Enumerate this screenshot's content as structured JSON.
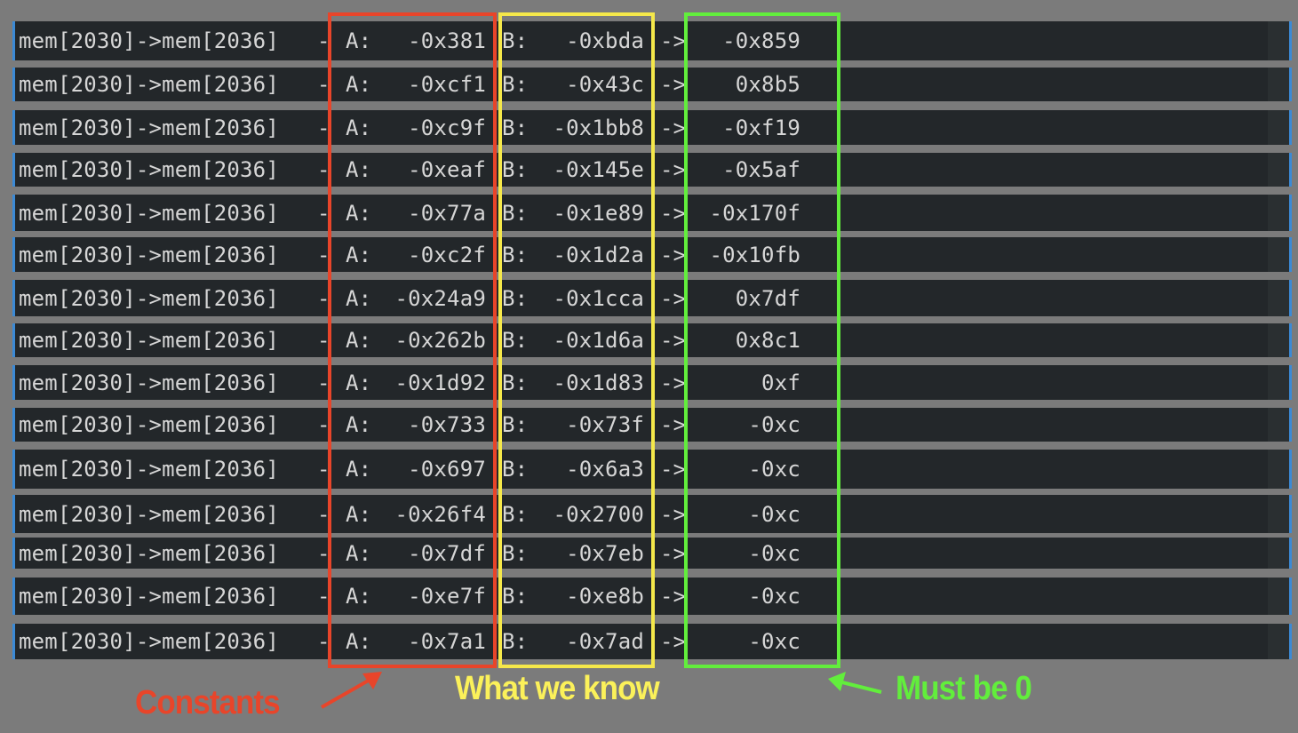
{
  "rows": [
    {
      "expr": "mem[2030]->mem[2036]",
      "sep": "-",
      "a_label": "A:",
      "a": "-0x381",
      "b_label": "B:",
      "b": "-0xbda",
      "arrow": "->",
      "result": "-0x859"
    },
    {
      "expr": "mem[2030]->mem[2036]",
      "sep": "-",
      "a_label": "A:",
      "a": "-0xcf1",
      "b_label": "B:",
      "b": "-0x43c",
      "arrow": "->",
      "result": "0x8b5"
    },
    {
      "expr": "mem[2030]->mem[2036]",
      "sep": "-",
      "a_label": "A:",
      "a": "-0xc9f",
      "b_label": "B:",
      "b": "-0x1bb8",
      "arrow": "->",
      "result": "-0xf19"
    },
    {
      "expr": "mem[2030]->mem[2036]",
      "sep": "-",
      "a_label": "A:",
      "a": "-0xeaf",
      "b_label": "B:",
      "b": "-0x145e",
      "arrow": "->",
      "result": "-0x5af"
    },
    {
      "expr": "mem[2030]->mem[2036]",
      "sep": "-",
      "a_label": "A:",
      "a": "-0x77a",
      "b_label": "B:",
      "b": "-0x1e89",
      "arrow": "->",
      "result": "-0x170f"
    },
    {
      "expr": "mem[2030]->mem[2036]",
      "sep": "-",
      "a_label": "A:",
      "a": "-0xc2f",
      "b_label": "B:",
      "b": "-0x1d2a",
      "arrow": "->",
      "result": "-0x10fb"
    },
    {
      "expr": "mem[2030]->mem[2036]",
      "sep": "-",
      "a_label": "A:",
      "a": "-0x24a9",
      "b_label": "B:",
      "b": "-0x1cca",
      "arrow": "->",
      "result": "0x7df"
    },
    {
      "expr": "mem[2030]->mem[2036]",
      "sep": "-",
      "a_label": "A:",
      "a": "-0x262b",
      "b_label": "B:",
      "b": "-0x1d6a",
      "arrow": "->",
      "result": "0x8c1"
    },
    {
      "expr": "mem[2030]->mem[2036]",
      "sep": "-",
      "a_label": "A:",
      "a": "-0x1d92",
      "b_label": "B:",
      "b": "-0x1d83",
      "arrow": "->",
      "result": "0xf"
    },
    {
      "expr": "mem[2030]->mem[2036]",
      "sep": "-",
      "a_label": "A:",
      "a": "-0x733",
      "b_label": "B:",
      "b": "-0x73f",
      "arrow": "->",
      "result": "-0xc"
    },
    {
      "expr": "mem[2030]->mem[2036]",
      "sep": "-",
      "a_label": "A:",
      "a": "-0x697",
      "b_label": "B:",
      "b": "-0x6a3",
      "arrow": "->",
      "result": "-0xc"
    },
    {
      "expr": "mem[2030]->mem[2036]",
      "sep": "-",
      "a_label": "A:",
      "a": "-0x26f4",
      "b_label": "B:",
      "b": "-0x2700",
      "arrow": "->",
      "result": "-0xc"
    },
    {
      "expr": "mem[2030]->mem[2036]",
      "sep": "-",
      "a_label": "A:",
      "a": "-0x7df",
      "b_label": "B:",
      "b": "-0x7eb",
      "arrow": "->",
      "result": "-0xc"
    },
    {
      "expr": "mem[2030]->mem[2036]",
      "sep": "-",
      "a_label": "A:",
      "a": "-0xe7f",
      "b_label": "B:",
      "b": "-0xe8b",
      "arrow": "->",
      "result": "-0xc"
    },
    {
      "expr": "mem[2030]->mem[2036]",
      "sep": "-",
      "a_label": "A:",
      "a": "-0x7a1",
      "b_label": "B:",
      "b": "-0x7ad",
      "arrow": "->",
      "result": "-0xc"
    }
  ],
  "annotations": {
    "constants": {
      "text": "Constants",
      "color": "#e8452a"
    },
    "what_we_know": {
      "text": "What we know",
      "color": "#fbf15a"
    },
    "must_be_zero": {
      "text": "Must be 0",
      "color": "#62ee3c"
    }
  }
}
